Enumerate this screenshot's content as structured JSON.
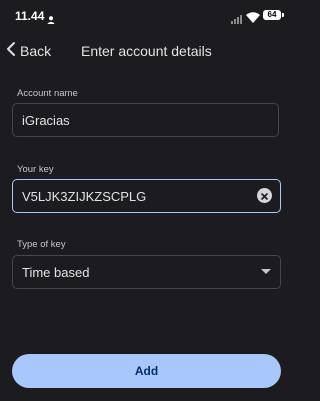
{
  "status_bar": {
    "time": "11.44",
    "battery": "64"
  },
  "header": {
    "back_label": "Back",
    "title": "Enter account details"
  },
  "form": {
    "account_name": {
      "label": "Account name",
      "value": "iGracias"
    },
    "your_key": {
      "label": "Your key",
      "value": "V5LJK3ZIJKZSCPLG"
    },
    "type_of_key": {
      "label": "Type of key",
      "value": "Time based"
    }
  },
  "actions": {
    "add_label": "Add"
  },
  "colors": {
    "background": "#1c1b1f",
    "accent": "#a8c7fa",
    "outline": "#49454f"
  }
}
